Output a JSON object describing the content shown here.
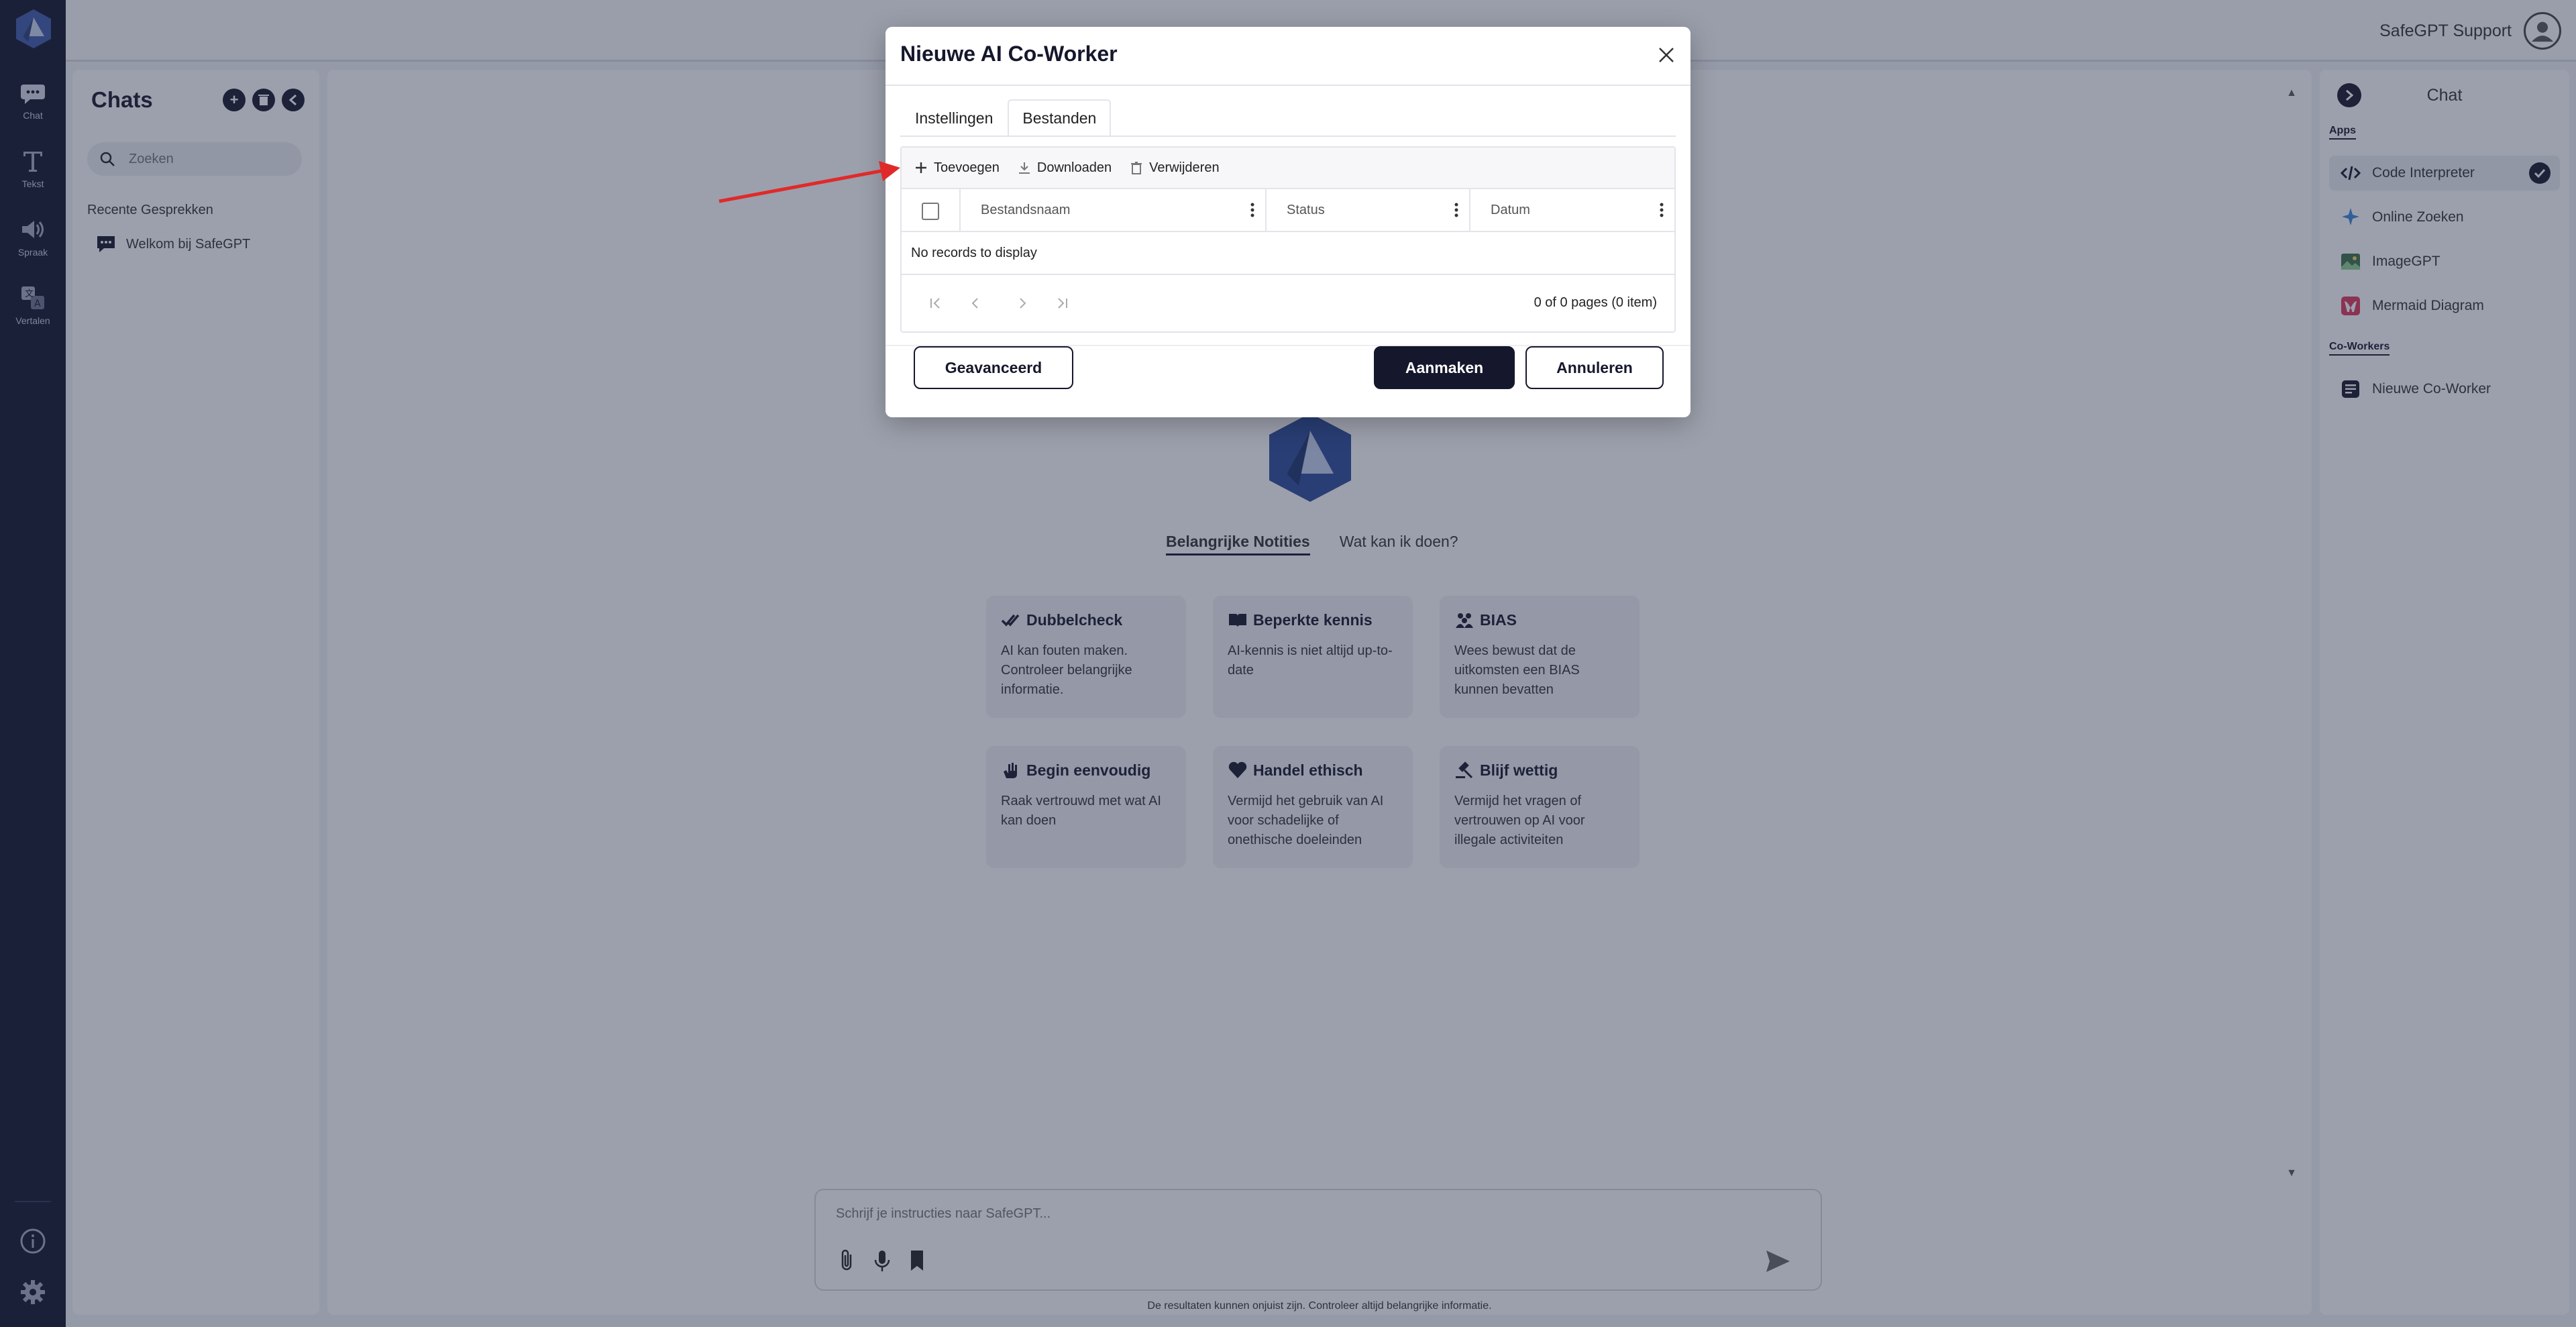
{
  "rail": {
    "items": [
      {
        "label": "Chat",
        "icon": "chat-bubble-icon"
      },
      {
        "label": "Tekst",
        "icon": "text-icon"
      },
      {
        "label": "Spraak",
        "icon": "speaker-icon"
      },
      {
        "label": "Vertalen",
        "icon": "translate-icon"
      }
    ],
    "bottom_icons": [
      "info-icon",
      "gear-icon"
    ]
  },
  "topbar": {
    "user_name": "SafeGPT Support"
  },
  "chats": {
    "title": "Chats",
    "search_placeholder": "Zoeken",
    "section_label": "Recente Gesprekken",
    "items": [
      "Welkom bij SafeGPT"
    ]
  },
  "main": {
    "tabs": [
      "Belangrijke Notities",
      "Wat kan ik doen?"
    ],
    "cards": [
      {
        "title": "Dubbelcheck",
        "body": "AI kan fouten maken. Controleer belangrijke informatie.",
        "icon": "double-check-icon"
      },
      {
        "title": "Beperkte kennis",
        "body": "AI-kennis is niet altijd up-to-date",
        "icon": "book-icon"
      },
      {
        "title": "BIAS",
        "body": "Wees bewust dat de uitkomsten een BIAS kunnen bevatten",
        "icon": "people-icon"
      },
      {
        "title": "Begin eenvoudig",
        "body": "Raak vertrouwd met wat AI kan doen",
        "icon": "hand-icon"
      },
      {
        "title": "Handel ethisch",
        "body": "Vermijd het gebruik van AI voor schadelijke of onethische doeleinden",
        "icon": "heart-icon"
      },
      {
        "title": "Blijf wettig",
        "body": "Vermijd het vragen of vertrouwen op AI voor illegale activiteiten",
        "icon": "gavel-icon"
      }
    ],
    "composer_placeholder": "Schrijf je instructies naar SafeGPT...",
    "disclaimer": "De resultaten kunnen onjuist zijn. Controleer altijd belangrijke informatie."
  },
  "rightpanel": {
    "title": "Chat",
    "apps_label": "Apps",
    "apps": [
      {
        "label": "Code Interpreter",
        "icon": "code-icon",
        "selected": true
      },
      {
        "label": "Online Zoeken",
        "icon": "sparkle-search-icon",
        "selected": false
      },
      {
        "label": "ImageGPT",
        "icon": "image-icon",
        "selected": false
      },
      {
        "label": "Mermaid Diagram",
        "icon": "mermaid-icon",
        "selected": false
      }
    ],
    "coworkers_label": "Co-Workers",
    "coworkers": [
      {
        "label": "Nieuwe Co-Worker",
        "icon": "coworker-icon"
      }
    ]
  },
  "modal": {
    "title": "Nieuwe AI Co-Worker",
    "tabs": [
      "Instellingen",
      "Bestanden"
    ],
    "active_tab": "Bestanden",
    "toolbar": {
      "add": "Toevoegen",
      "download": "Downloaden",
      "delete": "Verwijderen"
    },
    "columns": [
      "Bestandsnaam",
      "Status",
      "Datum"
    ],
    "empty_text": "No records to display",
    "pager_info": "0 of 0 pages (0 item)",
    "buttons": {
      "advanced": "Geavanceerd",
      "create": "Aanmaken",
      "cancel": "Annuleren"
    }
  },
  "colors": {
    "brand_dark": "#15172c",
    "annotation_arrow": "#e02a2a"
  }
}
